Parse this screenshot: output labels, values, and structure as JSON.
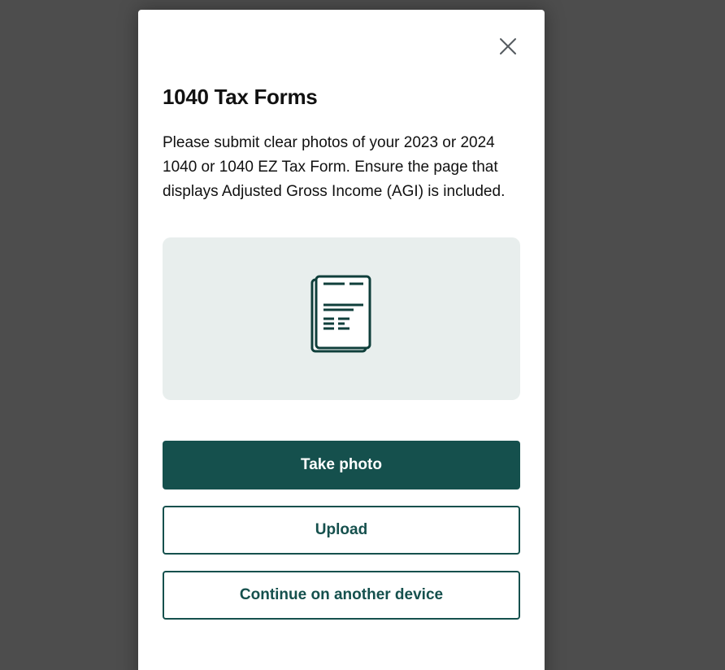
{
  "modal": {
    "title": "1040 Tax Forms",
    "description": "Please submit clear photos of your 2023 or 2024 1040 or 1040 EZ Tax Form. Ensure the page that displays Adjusted Gross Income (AGI) is included.",
    "illustration_icon": "tax-document-icon",
    "close_icon": "close-icon"
  },
  "buttons": {
    "take_photo": "Take photo",
    "upload": "Upload",
    "continue_other_device": "Continue on another device"
  },
  "colors": {
    "accent": "#15504d",
    "backdrop": "#4d4d4d",
    "illustration_bg": "#e8eeed"
  }
}
